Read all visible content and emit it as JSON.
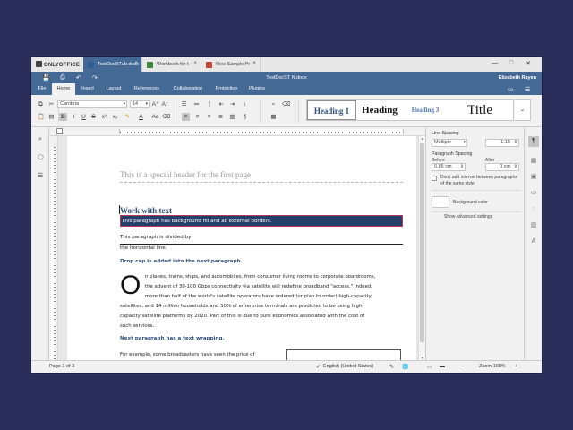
{
  "app": {
    "brand": "ONLYOFFICE",
    "tabs": [
      {
        "label": "TestDocSTub.docx",
        "active": true,
        "icon_color": "#2f5c95"
      },
      {
        "label": "Workbook for t",
        "active": false,
        "icon_color": "#3a8a3a"
      },
      {
        "label": "New Sample Pr",
        "active": false,
        "icon_color": "#c4462e"
      }
    ],
    "window_controls": {
      "minimize": "—",
      "restore": "□",
      "close": "✕"
    }
  },
  "header": {
    "doc_title": "TestDocST N.docx",
    "user_name": "Elizabeth Rayen",
    "quick_access": {
      "save": "💾",
      "print": "⎙",
      "undo": "↶",
      "redo": "↷"
    },
    "menus": [
      "File",
      "Home",
      "Insert",
      "Layout",
      "References",
      "Collaboration",
      "Protection",
      "Plugins"
    ],
    "active_menu": "Home",
    "right_icons": {
      "open_location": "▭",
      "options": "☰"
    }
  },
  "toolbar": {
    "font_name": "Carnbria",
    "font_size": "14",
    "bold": "B",
    "italic": "I",
    "underline": "U",
    "strike": "S",
    "superscript": "x²",
    "subscript": "x₂",
    "highlight": "✎",
    "font_color": "A",
    "case": "Aa",
    "grow": "A⁺",
    "shrink": "A⁻",
    "styles": [
      {
        "label": "Heading 1"
      },
      {
        "label": "Heading"
      },
      {
        "label": "Heading 3"
      },
      {
        "label": "Title"
      }
    ],
    "styles_dropdown": "⌄"
  },
  "document": {
    "header_text": "This is a special header for the first page",
    "heading": "Work with text",
    "highlight_para": "This paragraph has background fill and all external borders.",
    "divided_line1": "This paragraph is divided by",
    "divided_line2": "the horizontal line.",
    "dropcap_note": "Drop cap is added into the next paragraph.",
    "dropcap_letter": "O",
    "body_lines": [
      "n planes, trains, ships, and automobiles, from consumer living rooms to  corporate boardrooms,",
      "the advent of 30-100 Gbps connectivity via  satellite will redefine broadband \"access.\" Indeed,",
      "more than half of  the world's satellite operators have ordered (or plan to order)  high-capacity",
      "satellites, and 14 million households and 50% of  enterprise terminals are predicted to be using high-",
      "capacity satellite  platforms by 2020. Part of this is due to pure economics associated with  the cost of",
      "such services.."
    ],
    "wrap_note": "Next paragraph has a text wrapping.",
    "wrap_line": "For  example,  some  broadcasters  have  seen  the  price  of"
  },
  "right_panel": {
    "line_spacing_label": "Line Spacing",
    "line_spacing_mode": "Multiple",
    "line_spacing_value": "1.15",
    "paragraph_spacing_label": "Paragraph Spacing",
    "before_label": "Before",
    "after_label": "After",
    "before_value": "0.85 cm",
    "after_value": "0 cm",
    "dont_add_interval": "Don't add interval between paragraphs of the same style",
    "background_color_label": "Background color",
    "show_advanced": "Show advanced settings"
  },
  "status": {
    "page": "Page 1 of 3",
    "language": "English (United States)",
    "zoom": "Zoom 100%"
  }
}
